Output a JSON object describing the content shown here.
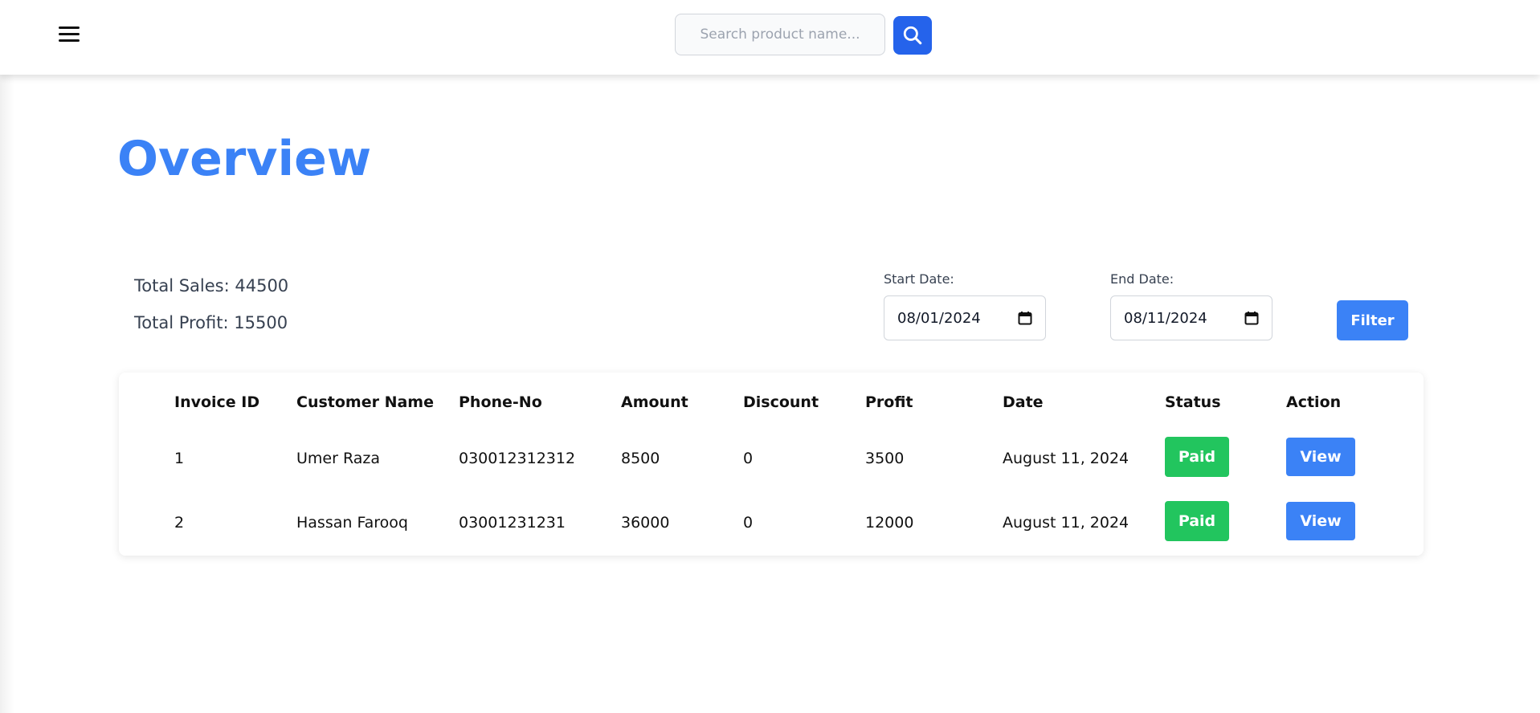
{
  "header": {
    "search_placeholder": "Search product name..."
  },
  "page": {
    "title": "Overview"
  },
  "stats": {
    "total_sales": "Total Sales: 44500",
    "total_profit": "Total Profit: 15500"
  },
  "filters": {
    "start_label": "Start Date:",
    "start_value": "08/01/2024",
    "end_label": "End Date:",
    "end_value": "08/11/2024",
    "filter_label": "Filter"
  },
  "table": {
    "columns": [
      "Invoice ID",
      "Customer Name",
      "Phone-No",
      "Amount",
      "Discount",
      "Profit",
      "Date",
      "Status",
      "Action"
    ],
    "rows": [
      {
        "invoice_id": "1",
        "customer": "Umer Raza",
        "phone": "030012312312",
        "amount": "8500",
        "discount": "0",
        "profit": "3500",
        "date": "August 11, 2024",
        "status": "Paid",
        "action": "View"
      },
      {
        "invoice_id": "2",
        "customer": "Hassan Farooq",
        "phone": "03001231231",
        "amount": "36000",
        "discount": "0",
        "profit": "12000",
        "date": "August 11, 2024",
        "status": "Paid",
        "action": "View"
      }
    ]
  },
  "colors": {
    "accent": "#3b82f6",
    "search_button": "#2563eb",
    "paid": "#22c55e"
  },
  "icons": {
    "menu": "hamburger-menu-icon",
    "search": "search-icon",
    "calendar": "calendar-icon"
  }
}
